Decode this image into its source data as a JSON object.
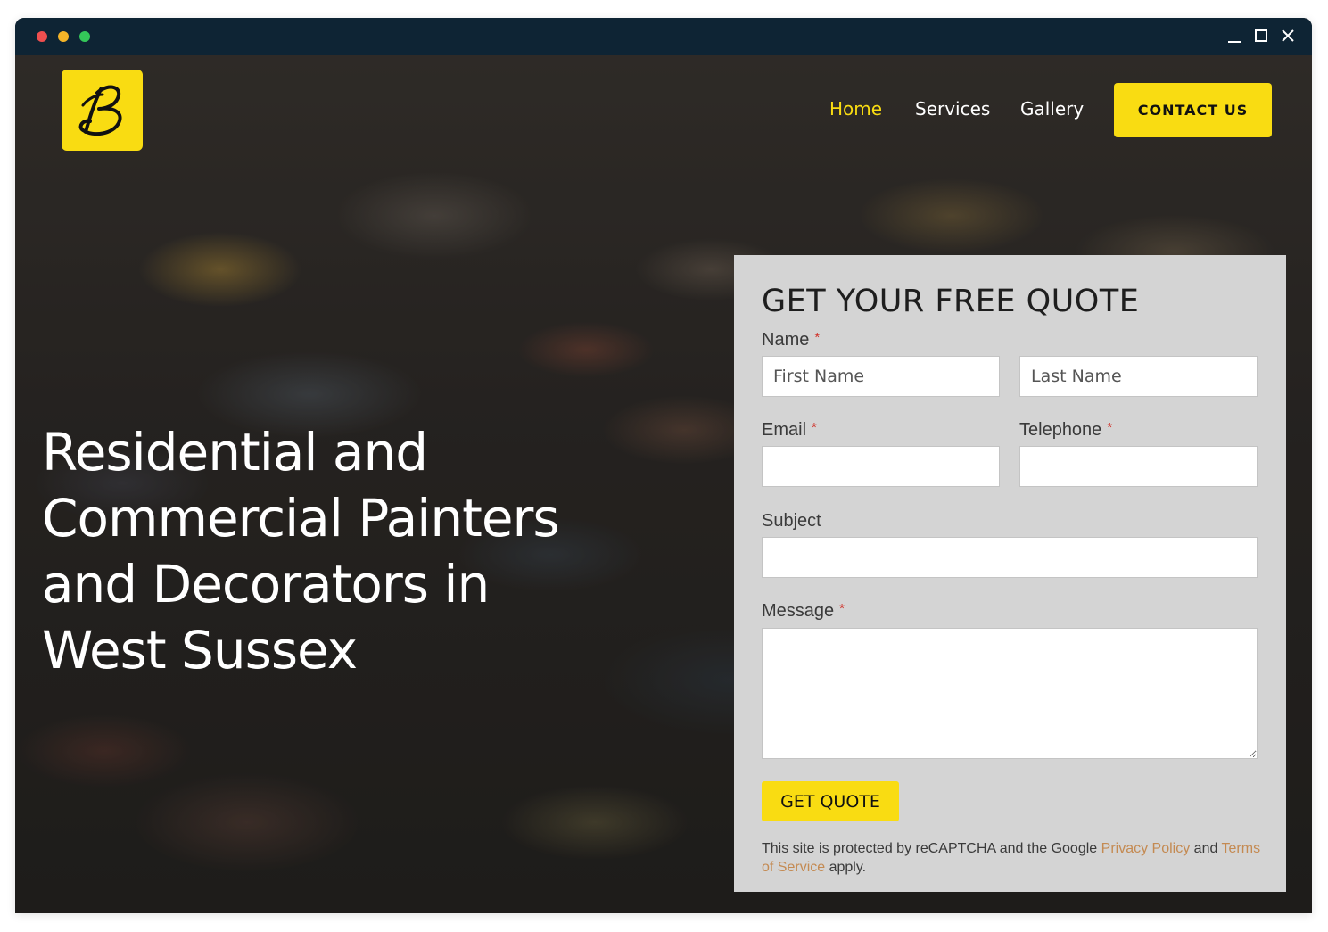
{
  "window": {
    "controls": [
      "minimize-icon",
      "maximize-icon",
      "close-icon"
    ]
  },
  "brand": {
    "logo_icon": "signature-b-logo",
    "logo_color": "#f9dc12"
  },
  "nav": {
    "items": [
      {
        "label": "Home",
        "active": true
      },
      {
        "label": "Services",
        "active": false
      },
      {
        "label": "Gallery",
        "active": false
      }
    ],
    "contact_label": "CONTACT US"
  },
  "hero": {
    "headline": "Residential and Commercial Painters and Decorators in West Sussex"
  },
  "form": {
    "title": "GET YOUR FREE QUOTE",
    "name_label": "Name",
    "first_name_placeholder": "First Name",
    "last_name_placeholder": "Last Name",
    "email_label": "Email",
    "telephone_label": "Telephone",
    "subject_label": "Subject",
    "message_label": "Message",
    "required_mark": "*",
    "submit_label": "GET QUOTE",
    "recaptcha": {
      "prefix": "This site is protected by reCAPTCHA and the Google",
      "privacy_link": "Privacy Policy",
      "middle": "and",
      "terms_link": "Terms of Service",
      "suffix": "apply."
    }
  },
  "colors": {
    "accent": "#f9dc12",
    "titlebar": "#0e2434",
    "panel": "#d4d4d4",
    "link": "#c48a52",
    "required": "#d0342c"
  }
}
